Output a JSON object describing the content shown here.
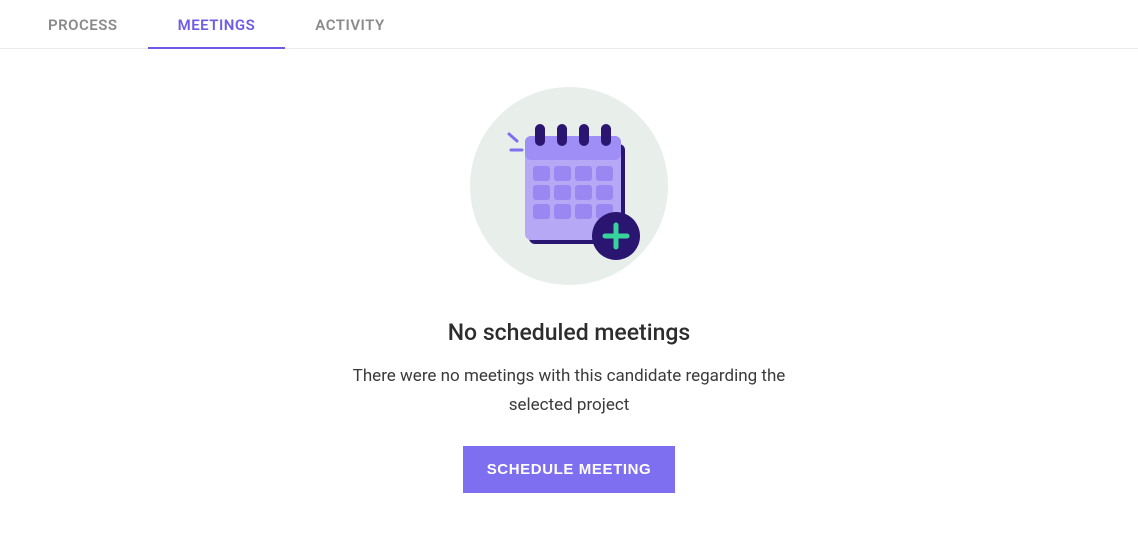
{
  "tabs": [
    {
      "label": "PROCESS",
      "active": false
    },
    {
      "label": "MEETINGS",
      "active": true
    },
    {
      "label": "ACTIVITY",
      "active": false
    }
  ],
  "empty_state": {
    "title": "No scheduled meetings",
    "subtitle": "There were no meetings with this candidate regarding the selected project",
    "cta_label": "SCHEDULE MEETING"
  }
}
